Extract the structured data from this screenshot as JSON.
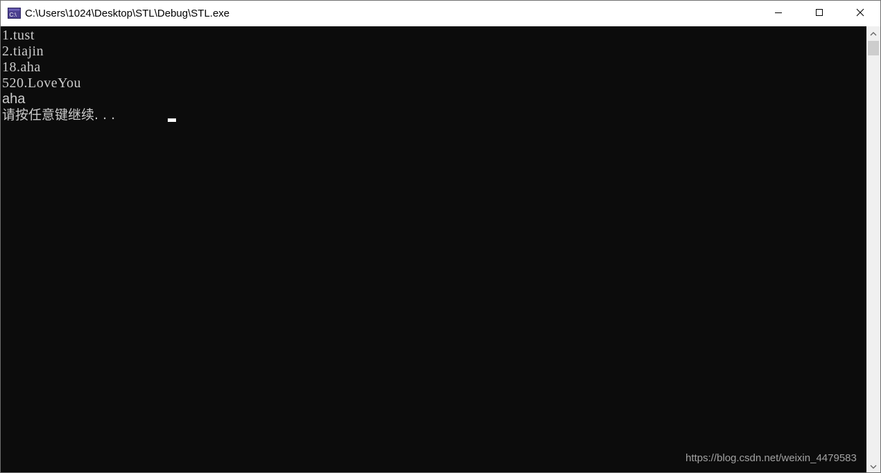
{
  "window": {
    "title": "C:\\Users\\1024\\Desktop\\STL\\Debug\\STL.exe",
    "app_icon": "console-icon",
    "controls": {
      "minimize": "minimize-icon",
      "maximize": "maximize-icon",
      "close": "close-icon"
    }
  },
  "console": {
    "lines": [
      "1.tust",
      "2.tiajin",
      "18.aha",
      "520.LoveYou",
      "aha",
      "请按任意键继续. . ."
    ],
    "background": "#0c0c0c",
    "foreground": "#cccccc"
  },
  "scrollbar": {
    "up": "scroll-up-arrow-icon",
    "down": "scroll-down-arrow-icon"
  },
  "watermark": "https://blog.csdn.net/weixin_4479583"
}
